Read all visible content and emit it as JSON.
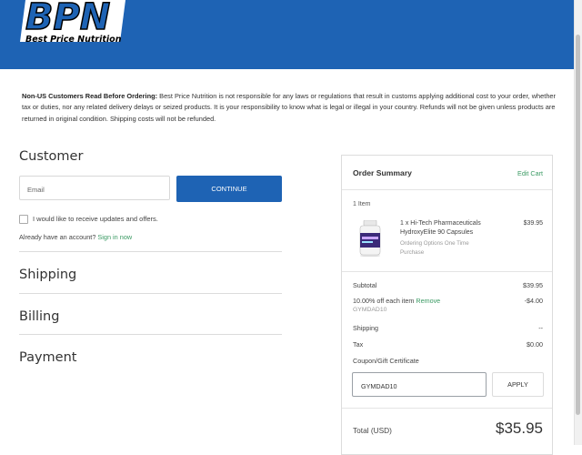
{
  "brand": {
    "name": "Best Price Nutrition",
    "mark": "BPN",
    "header_color": "#1e63b4",
    "accent_green": "#3a9a63"
  },
  "notice": {
    "heading": "Non-US Customers Read Before Ordering:",
    "body": "Best Price Nutrition is not responsible for any laws or regulations that result in customs applying additional cost to your order, whether tax or duties, nor any related delivery delays or seized products. It is your responsibility to know what is legal or illegal in your country. Refunds will not be given unless products are returned in original condition. Shipping costs will not be refunded."
  },
  "customer": {
    "title": "Customer",
    "email_placeholder": "Email",
    "continue_label": "CONTINUE",
    "updates_label": "I would like to receive updates and offers.",
    "updates_checked": false,
    "account_prompt": "Already have an account?",
    "sign_in_label": "Sign in now"
  },
  "sections": {
    "shipping": "Shipping",
    "billing": "Billing",
    "payment": "Payment"
  },
  "summary": {
    "title": "Order Summary",
    "edit_label": "Edit Cart",
    "item_count": "1 Item",
    "product": {
      "name": "1 x Hi-Tech Pharmaceuticals HydroxyElite 90 Capsules",
      "options": "Ordering Options One Time Purchase",
      "price": "$39.95",
      "icon": "supplement-bottle-image"
    },
    "subtotal_label": "Subtotal",
    "subtotal_value": "$39.95",
    "discount_label": "10.00% off each item",
    "discount_remove": "Remove",
    "discount_value": "-$4.00",
    "discount_code": "GYMDAD10",
    "shipping_label": "Shipping",
    "shipping_value": "--",
    "tax_label": "Tax",
    "tax_value": "$0.00",
    "coupon_label": "Coupon/Gift Certificate",
    "coupon_value": "GYMDAD10",
    "apply_label": "APPLY",
    "total_label": "Total (USD)",
    "total_value": "$35.95"
  }
}
